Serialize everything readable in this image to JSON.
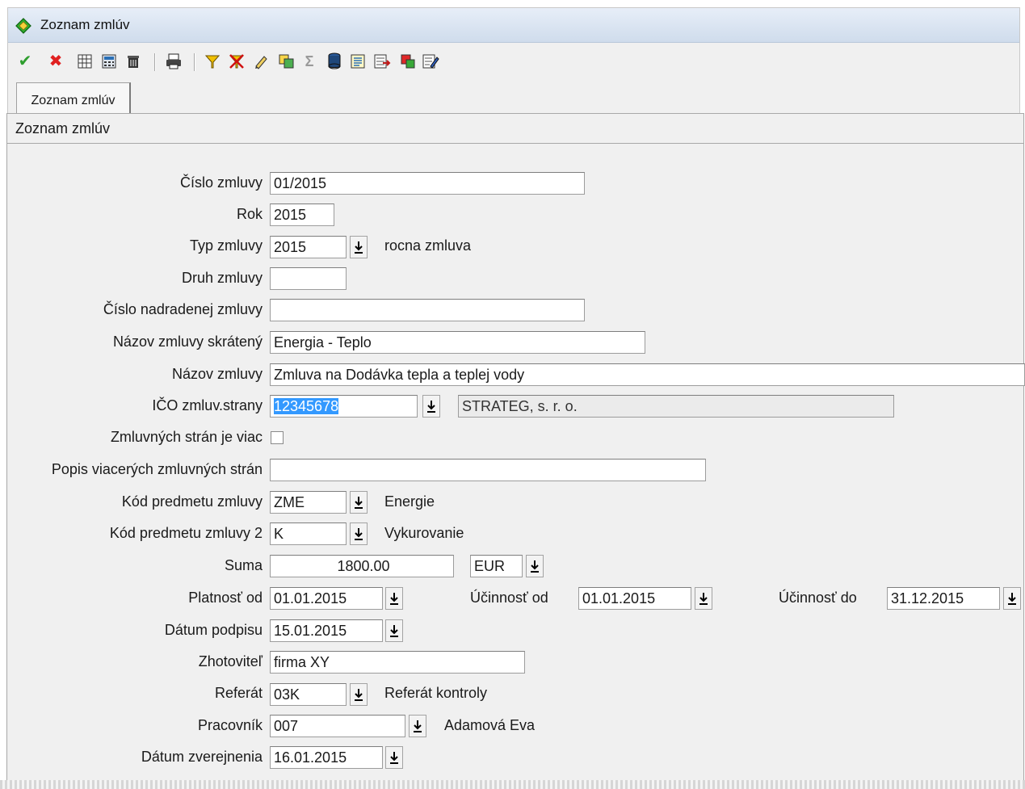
{
  "window": {
    "title": "Zoznam zmlúv"
  },
  "toolbar": {
    "icons": [
      "check-icon",
      "delete-icon",
      "grid-icon",
      "calculator-icon",
      "trash-icon",
      "print-icon",
      "filter-icon",
      "clear-filter-icon",
      "pen-icon",
      "copy-icon",
      "sum-icon",
      "database-icon",
      "report-icon",
      "export-icon",
      "windows-icon",
      "edit-icon"
    ],
    "sum_glyph": "Σ"
  },
  "tabs": [
    {
      "label": "Zoznam zmlúv"
    }
  ],
  "panel": {
    "title": "Zoznam zmlúv"
  },
  "form": {
    "cislo_zmluvy": {
      "label": "Číslo zmluvy",
      "value": "01/2015"
    },
    "rok": {
      "label": "Rok",
      "value": "2015"
    },
    "typ_zmluvy": {
      "label": "Typ  zmluvy",
      "value": "2015",
      "description": "rocna zmluva"
    },
    "druh_zmluvy": {
      "label": "Druh  zmluvy",
      "value": ""
    },
    "cislo_nadradenej": {
      "label": "Číslo nadradenej zmluvy",
      "value": ""
    },
    "nazov_skrateny": {
      "label": "Názov zmluvy skrátený",
      "value": "Energia - Teplo"
    },
    "nazov_zmluvy": {
      "label": "Názov zmluvy",
      "value": "Zmluva na Dodávka tepla a teplej vody"
    },
    "ico": {
      "label": "IČO zmluv.strany",
      "value": "12345678",
      "name": "STRATEG, s. r. o."
    },
    "viac_stran": {
      "label": "Zmluvných strán je viac",
      "checked": false
    },
    "popis_viacerych": {
      "label": "Popis viacerých zmluvných strán",
      "value": ""
    },
    "kod_predmetu": {
      "label": "Kód predmetu zmluvy",
      "value": "ZME",
      "description": "Energie"
    },
    "kod_predmetu_2": {
      "label": "Kód predmetu zmluvy 2",
      "value": "K",
      "description": "Vykurovanie"
    },
    "suma": {
      "label": "Suma",
      "value": "1800.00",
      "currency": "EUR"
    },
    "platnost_od": {
      "label": "Platnosť od",
      "value": "01.01.2015"
    },
    "ucinnost_od": {
      "label": "Účinnosť od",
      "value": "01.01.2015"
    },
    "ucinnost_do": {
      "label": "Účinnosť do",
      "value": "31.12.2015"
    },
    "datum_podpisu": {
      "label": "Dátum podpisu",
      "value": "15.01.2015"
    },
    "zhotovitel": {
      "label": "Zhotoviteľ",
      "value": "firma XY"
    },
    "referat": {
      "label": "Referát",
      "value": "03K",
      "description": "Referát kontroly"
    },
    "pracovnik": {
      "label": "Pracovník",
      "value": "007",
      "description": "Adamová Eva"
    },
    "datum_zverejnenia": {
      "label": "Dátum zverejnenia",
      "value": "16.01.2015"
    }
  },
  "colors": {
    "selection": "#3399ff",
    "accent_green": "#2e9e2e",
    "accent_red": "#e02020"
  }
}
